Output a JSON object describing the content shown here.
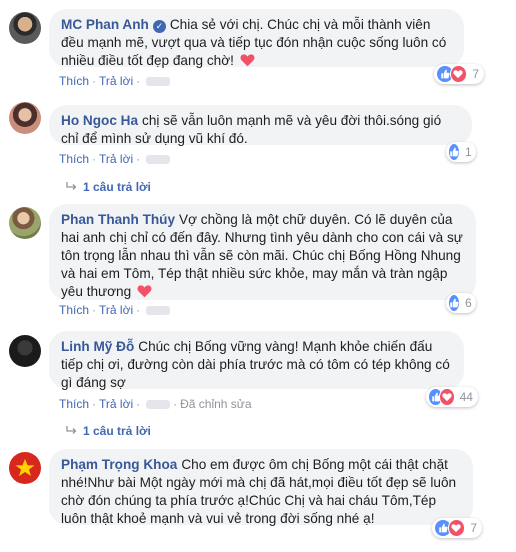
{
  "comments": [
    {
      "name": "MC Phan Anh",
      "verified": true,
      "text": "Chia sẻ với chị. Chúc chị và mỗi thành viên đều mạnh mẽ, vượt qua và tiếp tục đón nhận cuộc sống luôn có nhiều điều tốt đẹp đang chờ!",
      "emoji": "heart",
      "like_label": "Thích",
      "reply_label": "Trả lời",
      "reaction_count": "7",
      "reactions": [
        "like",
        "love"
      ]
    },
    {
      "name": "Ho Ngoc Ha",
      "verified": false,
      "text": "chị sẽ vẫn luôn mạnh mẽ và yêu đời thôi.sóng gió chỉ để mình sử dụng vũ khí đó.",
      "like_label": "Thích",
      "reply_label": "Trả lời",
      "reaction_count": "1",
      "reactions": [
        "like"
      ],
      "replies_label": "1 câu trả lời"
    },
    {
      "name": "Phan Thanh Thúy",
      "verified": false,
      "text": "Vợ chồng là một chữ duyên. Có lẽ duyên của hai anh chị chỉ có đến đây. Nhưng tình yêu dành cho con cái và sự tôn trọng lẫn nhau thì vẫn sẽ còn mãi. Chúc chị Bống Hồng Nhung và hai em Tôm, Tép thật nhiều sức khỏe, may mắn và tràn ngập yêu thương",
      "emoji": "heart",
      "like_label": "Thích",
      "reply_label": "Trả lời",
      "reaction_count": "6",
      "reactions": [
        "like"
      ]
    },
    {
      "name": "Linh Mỹ Đỗ",
      "verified": false,
      "text": "Chúc chị Bống vững vàng! Mạnh khỏe chiến đấu tiếp chị ơi, đường còn dài phía trước mà có tôm có tép không có gì đáng sợ",
      "like_label": "Thích",
      "reply_label": "Trả lời",
      "edited_label": "Đã chỉnh sửa",
      "reaction_count": "44",
      "reactions": [
        "like",
        "love"
      ],
      "replies_label": "1 câu trả lời"
    },
    {
      "name": "Phạm Trọng Khoa",
      "verified": false,
      "text": "Cho em được ôm chị Bống một cái thật chặt nhé!Như bài Một ngày mới mà chị đã hát,mọi điều tốt đẹp sẽ luôn chờ đón chúng ta phía trước ạ!Chúc Chị và hai cháu Tôm,Tép luôn thật khoẻ mạnh và vui vẻ trong đời sống nhé ạ!",
      "like_label": "Thích",
      "reply_label": "Trả lời",
      "reaction_count": "7",
      "reactions": [
        "like",
        "love"
      ]
    }
  ],
  "colors": {
    "name": "#385898",
    "bubble": "#f2f3f5",
    "like": "#5890ff",
    "love": "#f25268"
  }
}
